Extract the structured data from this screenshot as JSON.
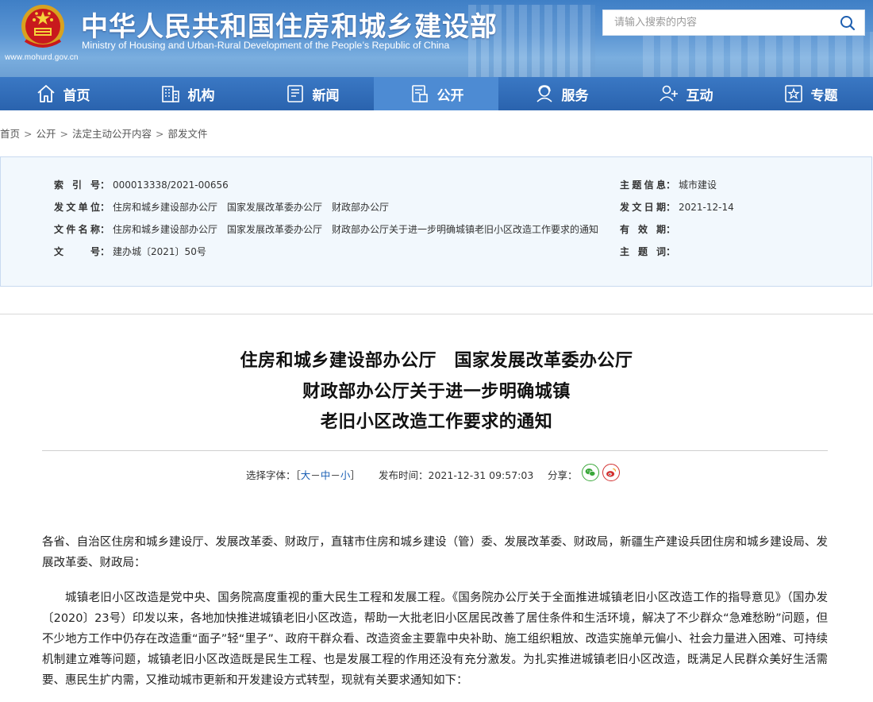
{
  "header": {
    "site_title": "中华人民共和国住房和城乡建设部",
    "site_subtitle": "Ministry of Housing and Urban-Rural Development of the People’s Republic of China",
    "site_url": "www.mohurd.gov.cn",
    "search": {
      "placeholder": "请输入搜索的内容"
    }
  },
  "nav": {
    "items": [
      {
        "label": "首页",
        "icon": "home-icon"
      },
      {
        "label": "机构",
        "icon": "building-icon"
      },
      {
        "label": "新闻",
        "icon": "news-icon"
      },
      {
        "label": "公开",
        "icon": "disclosure-icon",
        "active": true
      },
      {
        "label": "服务",
        "icon": "service-icon"
      },
      {
        "label": "互动",
        "icon": "interaction-icon"
      },
      {
        "label": "专题",
        "icon": "special-topic-icon"
      }
    ]
  },
  "breadcrumb": [
    "首页",
    "公开",
    "法定主动公开内容",
    "部发文件"
  ],
  "info": {
    "index_no": {
      "label": "索 引 号",
      "value": "000013338/2021-00656"
    },
    "issuer": {
      "label": "发文单位",
      "values": [
        "住房和城乡建设部办公厅",
        "国家发展改革委办公厅",
        "财政部办公厅"
      ]
    },
    "doc_name": {
      "label": "文件名称",
      "values": [
        "住房和城乡建设部办公厅",
        "国家发展改革委办公厅",
        "财政部办公厅关于进一步明确城镇老旧小区改造工作要求的通知"
      ]
    },
    "doc_no": {
      "label": "文　　号",
      "value": "建办城〔2021〕50号"
    },
    "topic": {
      "label": "主题信息",
      "value": "城市建设"
    },
    "date": {
      "label": "发文日期",
      "value": "2021-12-14"
    },
    "validity": {
      "label": "有 效 期",
      "value": ""
    },
    "keywords": {
      "label": "主 题 词",
      "value": ""
    }
  },
  "article": {
    "title_lines": [
      "住房和城乡建设部办公厅　国家发展改革委办公厅",
      "财政部办公厅关于进一步明确城镇",
      "老旧小区改造工作要求的通知"
    ],
    "meta": {
      "font_size_label": "选择字体：",
      "font_size_open": "［",
      "font_size_large": "大",
      "font_size_medium": "中",
      "font_size_small": "小",
      "font_size_sep": "－",
      "font_size_close": "］",
      "publish_label": "发布时间：",
      "publish_time": "2021-12-31 09:57:03",
      "share_label": "分享："
    },
    "addressee": "各省、自治区住房和城乡建设厅、发展改革委、财政厅，直辖市住房和城乡建设（管）委、发展改革委、财政局，新疆生产建设兵团住房和城乡建设局、发展改革委、财政局：",
    "paragraph1": "城镇老旧小区改造是党中央、国务院高度重视的重大民生工程和发展工程。《国务院办公厅关于全面推进城镇老旧小区改造工作的指导意见》（国办发〔2020〕23号）印发以来，各地加快推进城镇老旧小区改造，帮助一大批老旧小区居民改善了居住条件和生活环境，解决了不少群众“急难愁盼”问题，但不少地方工作中仍存在改造重“面子”轻“里子”、政府干群众看、改造资金主要靠中央补助、施工组织粗放、改造实施单元偏小、社会力量进入困难、可持续机制建立难等问题，城镇老旧小区改造既是民生工程、也是发展工程的作用还没有充分激发。为扎实推进城镇老旧小区改造，既满足人民群众美好生活需要、惠民生扩内需，又推动城市更新和开发建设方式转型，现就有关要求通知如下："
  },
  "colors": {
    "nav_bg": "#2a63ae",
    "nav_active": "#4d8bd3",
    "info_bg": "#f2f8fd",
    "link": "#1a5fb4"
  }
}
